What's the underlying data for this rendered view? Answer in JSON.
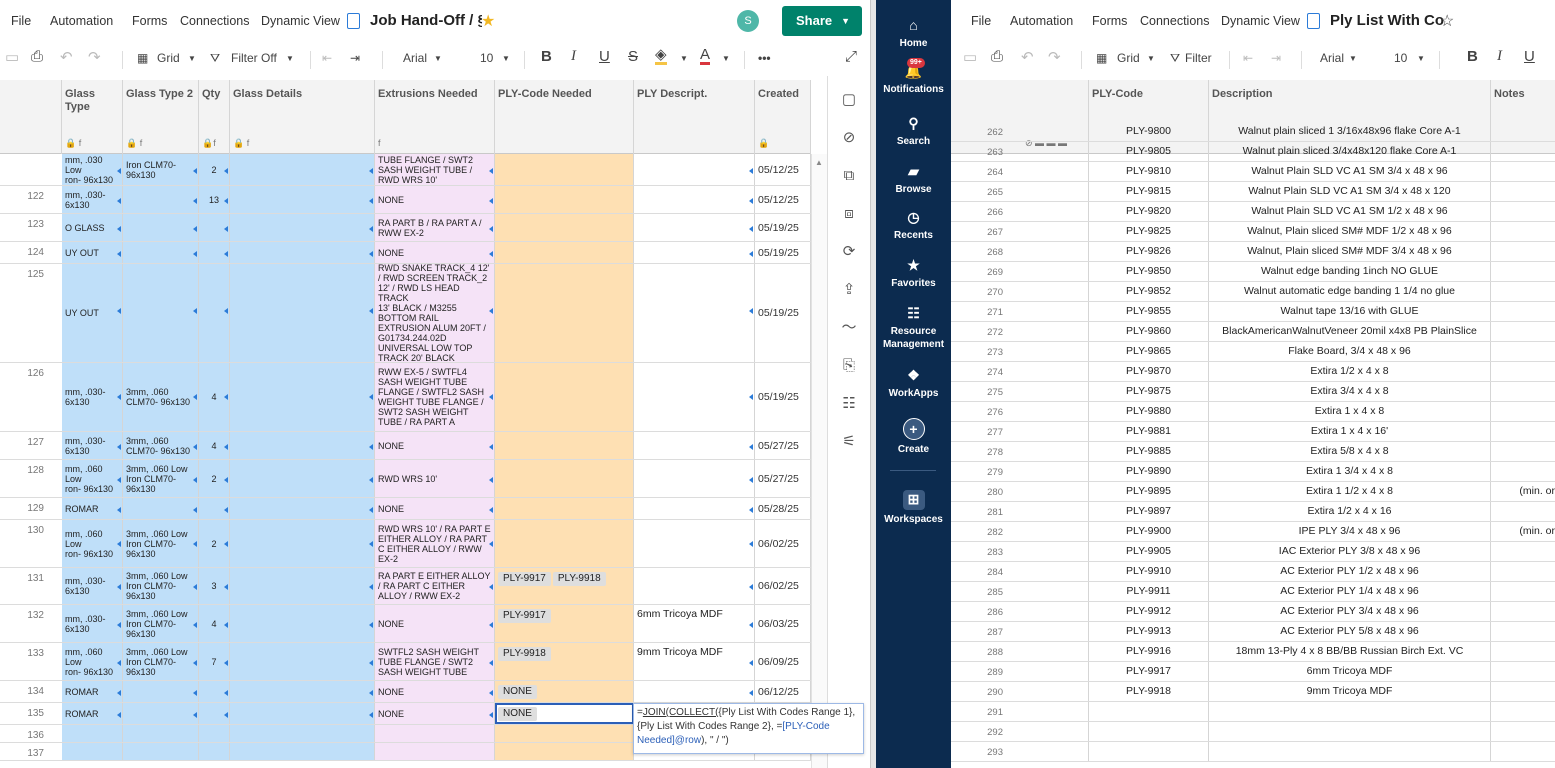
{
  "left": {
    "menu": [
      "File",
      "Automation",
      "Forms",
      "Connections",
      "Dynamic View"
    ],
    "sheet_title": "Job Hand-Off / §",
    "avatar_initial": "S",
    "share_label": "Share",
    "toolbar": {
      "view": "Grid",
      "filter": "Filter Off",
      "font": "Arial",
      "size": "10",
      "bold": "B",
      "italic": "I",
      "underline": "U",
      "strike": "S",
      "text_color": "A",
      "more": "•••"
    },
    "columns": [
      "Glass Type",
      "Glass Type 2",
      "Qty",
      "Glass Details",
      "Extrusions Needed",
      "PLY-Code Needed",
      "PLY Descript.",
      "Created"
    ],
    "rows": [
      {
        "n": "",
        "glass": "mm, .030 Low\nron- 96x130",
        "glass2": "Iron CLM70-\n96x130",
        "qty": "2",
        "ext": "TUBE FLANGE / SWT2\nSASH WEIGHT TUBE /\nRWD WRS 10'",
        "ply": [],
        "desc": "",
        "date": "05/12/25"
      },
      {
        "n": "122",
        "glass": "mm, .030-\n6x130",
        "glass2": "",
        "qty": "13",
        "ext": "NONE",
        "ply": [],
        "desc": "",
        "date": "05/12/25"
      },
      {
        "n": "123",
        "glass": "O GLASS",
        "glass2": "",
        "qty": "",
        "ext": "RA PART B / RA PART A /\nRWW EX-2",
        "ply": [],
        "desc": "",
        "date": "05/19/25"
      },
      {
        "n": "124",
        "glass": "UY OUT",
        "glass2": "",
        "qty": "",
        "ext": "NONE",
        "ply": [],
        "desc": "",
        "date": "05/19/25"
      },
      {
        "n": "125",
        "glass": "UY OUT",
        "glass2": "",
        "qty": "",
        "ext": "RWD SNAKE TRACK_4 12'\n/ RWD SCREEN TRACK_2\n12' / RWD LS HEAD TRACK\n13' BLACK / M3255\nBOTTOM RAIL\nEXTRUSION ALUM 20FT /\nG01734.244.02D\nUNIVERSAL LOW TOP\nTRACK 20' BLACK",
        "ply": [],
        "desc": "",
        "date": "05/19/25"
      },
      {
        "n": "126",
        "glass": "mm, .030-\n6x130",
        "glass2": "3mm, .060\nCLM70- 96x130",
        "qty": "4",
        "ext": "RWW EX-5 / SWTFL4\nSASH WEIGHT TUBE\nFLANGE / SWTFL2 SASH\nWEIGHT TUBE FLANGE /\nSWT2 SASH WEIGHT\nTUBE / RA PART A",
        "ply": [],
        "desc": "",
        "date": "05/19/25"
      },
      {
        "n": "127",
        "glass": "mm, .030-\n6x130",
        "glass2": "3mm, .060\nCLM70- 96x130",
        "qty": "4",
        "ext": "NONE",
        "ply": [],
        "desc": "",
        "date": "05/27/25"
      },
      {
        "n": "128",
        "glass": "mm, .060 Low\nron- 96x130",
        "glass2": "3mm, .060 Low\nIron CLM70-\n96x130",
        "qty": "2",
        "ext": "RWD WRS 10'",
        "ply": [],
        "desc": "",
        "date": "05/27/25"
      },
      {
        "n": "129",
        "glass": "ROMAR",
        "glass2": "",
        "qty": "",
        "ext": "NONE",
        "ply": [],
        "desc": "",
        "date": "05/28/25"
      },
      {
        "n": "130",
        "glass": "mm, .060 Low\nron- 96x130",
        "glass2": "3mm, .060 Low\nIron CLM70-\n96x130",
        "qty": "2",
        "ext": "RWD WRS 10' / RA PART E\nEITHER ALLOY / RA PART\nC EITHER ALLOY / RWW\nEX-2",
        "ply": [],
        "desc": "",
        "date": "06/02/25"
      },
      {
        "n": "131",
        "glass": "mm, .030-\n6x130",
        "glass2": "3mm, .060 Low\nIron CLM70-\n96x130",
        "qty": "3",
        "ext": "RA PART E EITHER ALLOY\n/ RA PART C EITHER\nALLOY / RWW EX-2",
        "ply": [
          "PLY-9917",
          "PLY-9918"
        ],
        "desc": "",
        "date": "06/02/25"
      },
      {
        "n": "132",
        "glass": "mm, .030-\n6x130",
        "glass2": "3mm, .060 Low\nIron CLM70-\n96x130",
        "qty": "4",
        "ext": "NONE",
        "ply": [
          "PLY-9917"
        ],
        "desc": "6mm Tricoya MDF",
        "date": "06/03/25"
      },
      {
        "n": "133",
        "glass": "mm, .060 Low\nron- 96x130",
        "glass2": "3mm, .060 Low\nIron CLM70-\n96x130",
        "qty": "7",
        "ext": "SWTFL2 SASH WEIGHT\nTUBE FLANGE / SWT2\nSASH WEIGHT TUBE",
        "ply": [
          "PLY-9918"
        ],
        "desc": "9mm Tricoya MDF",
        "date": "06/09/25"
      },
      {
        "n": "134",
        "glass": "ROMAR",
        "glass2": "",
        "qty": "",
        "ext": "NONE",
        "ply": [
          "NONE"
        ],
        "desc": "",
        "date": "06/12/25"
      },
      {
        "n": "135",
        "glass": "ROMAR",
        "glass2": "",
        "qty": "",
        "ext": "NONE",
        "ply": [
          "NONE"
        ],
        "desc": "",
        "date": ""
      },
      {
        "n": "136",
        "glass": "",
        "glass2": "",
        "qty": "",
        "ext": "",
        "ply": [],
        "desc": "",
        "date": ""
      },
      {
        "n": "137",
        "glass": "",
        "glass2": "",
        "qty": "",
        "ext": "",
        "ply": [],
        "desc": "",
        "date": ""
      }
    ],
    "formula": {
      "plain1": "=",
      "fn": "JOIN(COLLECT(",
      "ref1": "{Ply List With Codes Range 1}",
      "sep": ", ",
      "ref2": "{Ply List With Codes Range 2}",
      "eq": ", =",
      "ref3": "[PLY-Code Needed]@row",
      "tail": "), \" / \")"
    }
  },
  "nav": {
    "items": [
      {
        "label": "Home",
        "icon": "home-icon"
      },
      {
        "label": "Notifications",
        "icon": "bell-icon",
        "badge": "99+"
      },
      {
        "label": "Search",
        "icon": "search-icon"
      },
      {
        "label": "Browse",
        "icon": "folder-icon"
      },
      {
        "label": "Recents",
        "icon": "clock-icon"
      },
      {
        "label": "Favorites",
        "icon": "star-icon"
      },
      {
        "label": "Resource Management",
        "icon": "people-icon"
      },
      {
        "label": "WorkApps",
        "icon": "workapps-icon"
      },
      {
        "label": "Create",
        "icon": "plus-icon"
      },
      {
        "label": "Workspaces",
        "icon": "workspaces-icon"
      }
    ]
  },
  "right": {
    "menu": [
      "File",
      "Automation",
      "Forms",
      "Connections",
      "Dynamic View"
    ],
    "sheet_title": "Ply List With Co",
    "toolbar": {
      "view": "Grid",
      "filter": "Filter",
      "font": "Arial",
      "size": "10",
      "bold": "B",
      "italic": "I",
      "underline": "U"
    },
    "columns": [
      "PLY-Code",
      "Description",
      "Notes"
    ],
    "rows": [
      {
        "n": "262",
        "code": "PLY-9800",
        "desc": "Walnut plain sliced 1 3/16x48x96 flake Core A-1",
        "notes": ""
      },
      {
        "n": "263",
        "code": "PLY-9805",
        "desc": "Walnut plain sliced 3/4x48x120 flake Core A-1",
        "notes": ""
      },
      {
        "n": "264",
        "code": "PLY-9810",
        "desc": "Walnut Plain SLD VC A1 SM 3/4 x 48 x 96",
        "notes": ""
      },
      {
        "n": "265",
        "code": "PLY-9815",
        "desc": "Walnut Plain SLD VC A1 SM 3/4 x 48 x 120",
        "notes": ""
      },
      {
        "n": "266",
        "code": "PLY-9820",
        "desc": "Walnut Plain SLD VC A1 SM 1/2 x 48 x 96",
        "notes": ""
      },
      {
        "n": "267",
        "code": "PLY-9825",
        "desc": "Walnut, Plain sliced SM# MDF 1/2 x 48 x 96",
        "notes": ""
      },
      {
        "n": "268",
        "code": "PLY-9826",
        "desc": "Walnut, Plain sliced SM# MDF 3/4 x 48 x 96",
        "notes": ""
      },
      {
        "n": "269",
        "code": "PLY-9850",
        "desc": "Walnut edge banding 1inch NO GLUE",
        "notes": ""
      },
      {
        "n": "270",
        "code": "PLY-9852",
        "desc": "Walnut automatic edge banding 1 1/4 no glue",
        "notes": ""
      },
      {
        "n": "271",
        "code": "PLY-9855",
        "desc": "Walnut tape 13/16 with GLUE",
        "notes": ""
      },
      {
        "n": "272",
        "code": "PLY-9860",
        "desc": "BlackAmericanWalnutVeneer 20mil x4x8 PB PlainSlice",
        "notes": ""
      },
      {
        "n": "273",
        "code": "PLY-9865",
        "desc": "Flake Board, 3/4 x 48 x 96",
        "notes": ""
      },
      {
        "n": "274",
        "code": "PLY-9870",
        "desc": "Extira 1/2 x 4 x 8",
        "notes": ""
      },
      {
        "n": "275",
        "code": "PLY-9875",
        "desc": "Extira 3/4 x 4 x 8",
        "notes": ""
      },
      {
        "n": "276",
        "code": "PLY-9880",
        "desc": "Extira 1 x 4 x 8",
        "notes": ""
      },
      {
        "n": "277",
        "code": "PLY-9881",
        "desc": "Extira 1 x 4 x 16'",
        "notes": ""
      },
      {
        "n": "278",
        "code": "PLY-9885",
        "desc": "Extira 5/8 x 4 x 8",
        "notes": ""
      },
      {
        "n": "279",
        "code": "PLY-9890",
        "desc": "Extira 1 3/4 x 4 x 8",
        "notes": ""
      },
      {
        "n": "280",
        "code": "PLY-9895",
        "desc": "Extira 1 1/2 x 4 x 8",
        "notes": "(min. or"
      },
      {
        "n": "281",
        "code": "PLY-9897",
        "desc": "Extira 1/2 x 4 x 16",
        "notes": ""
      },
      {
        "n": "282",
        "code": "PLY-9900",
        "desc": "IPE PLY 3/4 x 48 x 96",
        "notes": "(min. or"
      },
      {
        "n": "283",
        "code": "PLY-9905",
        "desc": "IAC Exterior PLY 3/8 x 48 x 96",
        "notes": ""
      },
      {
        "n": "284",
        "code": "PLY-9910",
        "desc": "AC Exterior PLY 1/2 x 48 x 96",
        "notes": ""
      },
      {
        "n": "285",
        "code": "PLY-9911",
        "desc": "AC Exterior PLY 1/4 x 48 x 96",
        "notes": ""
      },
      {
        "n": "286",
        "code": "PLY-9912",
        "desc": "AC Exterior PLY 3/4 x 48 x 96",
        "notes": ""
      },
      {
        "n": "287",
        "code": "PLY-9913",
        "desc": "AC Exterior PLY 5/8 x 48 x 96",
        "notes": ""
      },
      {
        "n": "288",
        "code": "PLY-9916",
        "desc": "18mm 13-Ply 4 x 8 BB/BB Russian Birch Ext. VC",
        "notes": ""
      },
      {
        "n": "289",
        "code": "PLY-9917",
        "desc": "6mm Tricoya MDF",
        "notes": ""
      },
      {
        "n": "290",
        "code": "PLY-9918",
        "desc": "9mm Tricoya MDF",
        "notes": ""
      },
      {
        "n": "291",
        "code": "",
        "desc": "",
        "notes": ""
      },
      {
        "n": "292",
        "code": "",
        "desc": "",
        "notes": ""
      },
      {
        "n": "293",
        "code": "",
        "desc": "",
        "notes": ""
      }
    ]
  },
  "colors": {
    "share": "#00826b",
    "nav": "#0c2b4f",
    "glass_col": "#bfdff9",
    "ext_col": "#f5e3f7",
    "ply_col": "#fee0b3"
  }
}
